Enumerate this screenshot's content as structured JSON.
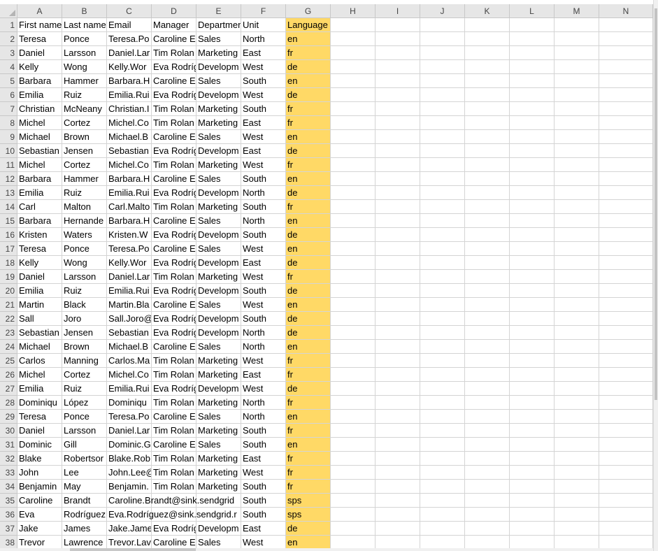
{
  "columns": [
    "A",
    "B",
    "C",
    "D",
    "E",
    "F",
    "G",
    "H",
    "I",
    "J",
    "K",
    "L",
    "M",
    "N"
  ],
  "colors": {
    "highlight": "#ffd966",
    "header_bg": "#e6e6e6",
    "gridline": "#d4d4d4"
  },
  "rows": [
    {
      "num": "1",
      "cells": [
        "First name",
        "Last name",
        "Email",
        "Manager",
        "Department",
        "Unit",
        "Language"
      ]
    },
    {
      "num": "2",
      "cells": [
        "Teresa",
        "Ponce",
        "Teresa.Po",
        "Caroline E",
        "Sales",
        "North",
        "en"
      ]
    },
    {
      "num": "3",
      "cells": [
        "Daniel",
        "Larsson",
        "Daniel.Lar",
        "Tim Rolan",
        "Marketing",
        "East",
        "fr"
      ]
    },
    {
      "num": "4",
      "cells": [
        "Kelly",
        "Wong",
        "Kelly.Wor",
        "Eva Rodríg",
        "Developm",
        "West",
        "de"
      ]
    },
    {
      "num": "5",
      "cells": [
        "Barbara",
        "Hammer",
        "Barbara.H",
        "Caroline E",
        "Sales",
        "South",
        "en"
      ]
    },
    {
      "num": "6",
      "cells": [
        "Emilia",
        "Ruiz",
        "Emilia.Rui",
        "Eva Rodríg",
        "Developm",
        "West",
        "de"
      ]
    },
    {
      "num": "7",
      "cells": [
        "Christian",
        "McNeany",
        "Christian.I",
        "Tim Rolan",
        "Marketing",
        "South",
        "fr"
      ]
    },
    {
      "num": "8",
      "cells": [
        "Michel",
        "Cortez",
        "Michel.Co",
        "Tim Rolan",
        "Marketing",
        "East",
        "fr"
      ]
    },
    {
      "num": "9",
      "cells": [
        "Michael",
        "Brown",
        "Michael.B",
        "Caroline E",
        "Sales",
        "West",
        "en"
      ]
    },
    {
      "num": "10",
      "cells": [
        "Sebastian",
        "Jensen",
        "Sebastian",
        "Eva Rodríg",
        "Developm",
        "East",
        "de"
      ]
    },
    {
      "num": "11",
      "cells": [
        "Michel",
        "Cortez",
        "Michel.Co",
        "Tim Rolan",
        "Marketing",
        "West",
        "fr"
      ]
    },
    {
      "num": "12",
      "cells": [
        "Barbara",
        "Hammer",
        "Barbara.H",
        "Caroline E",
        "Sales",
        "South",
        "en"
      ]
    },
    {
      "num": "13",
      "cells": [
        "Emilia",
        "Ruiz",
        "Emilia.Rui",
        "Eva Rodríg",
        "Developm",
        "North",
        "de"
      ]
    },
    {
      "num": "14",
      "cells": [
        "Carl",
        "Malton",
        "Carl.Malto",
        "Tim Rolan",
        "Marketing",
        "South",
        "fr"
      ]
    },
    {
      "num": "15",
      "cells": [
        "Barbara",
        "Hernande",
        "Barbara.H",
        "Caroline E",
        "Sales",
        "North",
        "en"
      ]
    },
    {
      "num": "16",
      "cells": [
        "Kristen",
        "Waters",
        "Kristen.W",
        "Eva Rodríg",
        "Developm",
        "South",
        "de"
      ]
    },
    {
      "num": "17",
      "cells": [
        "Teresa",
        "Ponce",
        "Teresa.Po",
        "Caroline E",
        "Sales",
        "West",
        "en"
      ]
    },
    {
      "num": "18",
      "cells": [
        "Kelly",
        "Wong",
        "Kelly.Wor",
        "Eva Rodríg",
        "Developm",
        "East",
        "de"
      ]
    },
    {
      "num": "19",
      "cells": [
        "Daniel",
        "Larsson",
        "Daniel.Lar",
        "Tim Rolan",
        "Marketing",
        "West",
        "fr"
      ]
    },
    {
      "num": "20",
      "cells": [
        "Emilia",
        "Ruiz",
        "Emilia.Rui",
        "Eva Rodríg",
        "Developm",
        "South",
        "de"
      ]
    },
    {
      "num": "21",
      "cells": [
        "Martin",
        "Black",
        "Martin.Bla",
        "Caroline E",
        "Sales",
        "West",
        "en"
      ]
    },
    {
      "num": "22",
      "cells": [
        "Sall",
        "Joro",
        "Sall.Joro@",
        "Eva Rodríg",
        "Developm",
        "South",
        "de"
      ]
    },
    {
      "num": "23",
      "cells": [
        "Sebastian",
        "Jensen",
        "Sebastian",
        "Eva Rodríg",
        "Developm",
        "North",
        "de"
      ]
    },
    {
      "num": "24",
      "cells": [
        "Michael",
        "Brown",
        "Michael.B",
        "Caroline E",
        "Sales",
        "North",
        "en"
      ]
    },
    {
      "num": "25",
      "cells": [
        "Carlos",
        "Manning",
        "Carlos.Ma",
        "Tim Rolan",
        "Marketing",
        "West",
        "fr"
      ]
    },
    {
      "num": "26",
      "cells": [
        "Michel",
        "Cortez",
        "Michel.Co",
        "Tim Rolan",
        "Marketing",
        "East",
        "fr"
      ]
    },
    {
      "num": "27",
      "cells": [
        "Emilia",
        "Ruiz",
        "Emilia.Rui",
        "Eva Rodríg",
        "Developm",
        "West",
        "de"
      ]
    },
    {
      "num": "28",
      "cells": [
        "Dominiqu",
        "López",
        "Dominiqu",
        "Tim Rolan",
        "Marketing",
        "North",
        "fr"
      ]
    },
    {
      "num": "29",
      "cells": [
        "Teresa",
        "Ponce",
        "Teresa.Po",
        "Caroline E",
        "Sales",
        "North",
        "en"
      ]
    },
    {
      "num": "30",
      "cells": [
        "Daniel",
        "Larsson",
        "Daniel.Lar",
        "Tim Rolan",
        "Marketing",
        "South",
        "fr"
      ]
    },
    {
      "num": "31",
      "cells": [
        "Dominic",
        "Gill",
        "Dominic.G",
        "Caroline E",
        "Sales",
        "South",
        "en"
      ]
    },
    {
      "num": "32",
      "cells": [
        "Blake",
        "Robertsor",
        "Blake.Rob",
        "Tim Rolan",
        "Marketing",
        "East",
        "fr"
      ]
    },
    {
      "num": "33",
      "cells": [
        "John",
        "Lee",
        "John.Lee@",
        "Tim Rolan",
        "Marketing",
        "West",
        "fr"
      ]
    },
    {
      "num": "34",
      "cells": [
        "Benjamin",
        "May",
        "Benjamin.",
        "Tim Rolan",
        "Marketing",
        "South",
        "fr"
      ]
    },
    {
      "num": "35",
      "cells": [
        "Caroline",
        "Brandt",
        "Caroline.Brandt@sink.sendgrid",
        "",
        "",
        "South",
        "sps"
      ]
    },
    {
      "num": "36",
      "cells": [
        "Eva",
        "Rodríguez",
        "Eva.Rodríguez@sink.sendgrid.r",
        "",
        "",
        "South",
        "sps"
      ]
    },
    {
      "num": "37",
      "cells": [
        "Jake",
        "James",
        "Jake.Jame",
        "Eva Rodríg",
        "Developm",
        "East",
        "de"
      ]
    },
    {
      "num": "38",
      "cells": [
        "Trevor",
        "Lawrence",
        "Trevor.Lav",
        "Caroline E",
        "Sales",
        "West",
        "en"
      ]
    }
  ]
}
